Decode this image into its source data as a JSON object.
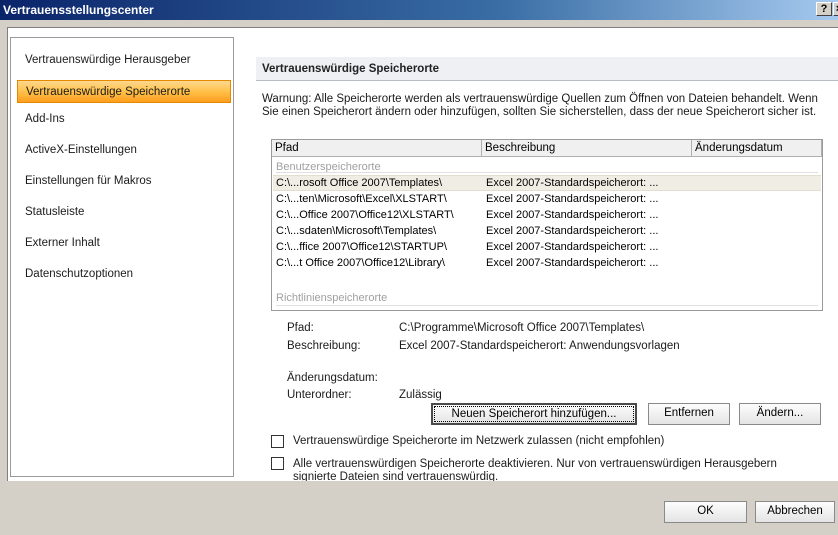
{
  "window": {
    "title": "Vertrauensstellungscenter",
    "help_glyph": "?",
    "close_glyph": "×"
  },
  "sidebar": {
    "items": [
      {
        "label": "Vertrauenswürdige Herausgeber"
      },
      {
        "label": "Vertrauenswürdige Speicherorte",
        "active": true
      },
      {
        "label": "Add-Ins"
      },
      {
        "label": "ActiveX-Einstellungen"
      },
      {
        "label": "Einstellungen für Makros"
      },
      {
        "label": "Statusleiste"
      },
      {
        "label": "Externer Inhalt"
      },
      {
        "label": "Datenschutzoptionen"
      }
    ]
  },
  "content": {
    "section_title": "Vertrauenswürdige Speicherorte",
    "warning": "Warnung: Alle Speicherorte werden als vertrauenswürdige Quellen zum Öffnen von Dateien behandelt. Wenn Sie einen Speicherort ändern oder hinzufügen, sollten Sie sicherstellen, dass der neue Speicherort sicher ist.",
    "list": {
      "columns": [
        "Pfad",
        "Beschreibung",
        "Änderungsdatum"
      ],
      "group_user": "Benutzerspeicherorte",
      "group_policy": "Richtlinienspeicherorte",
      "rows": [
        {
          "path": "C:\\...rosoft Office 2007\\Templates\\",
          "desc": "Excel 2007-Standardspeicherort: ...",
          "date": ""
        },
        {
          "path": "C:\\...ten\\Microsoft\\Excel\\XLSTART\\",
          "desc": "Excel 2007-Standardspeicherort: ...",
          "date": ""
        },
        {
          "path": "C:\\...Office 2007\\Office12\\XLSTART\\",
          "desc": "Excel 2007-Standardspeicherort: ...",
          "date": ""
        },
        {
          "path": "C:\\...sdaten\\Microsoft\\Templates\\",
          "desc": "Excel 2007-Standardspeicherort: ...",
          "date": ""
        },
        {
          "path": "C:\\...ffice 2007\\Office12\\STARTUP\\",
          "desc": "Excel 2007-Standardspeicherort: ...",
          "date": ""
        },
        {
          "path": "C:\\...t Office 2007\\Office12\\Library\\",
          "desc": "Excel 2007-Standardspeicherort: ...",
          "date": ""
        }
      ]
    },
    "details": {
      "path_label": "Pfad:",
      "path_value": "C:\\Programme\\Microsoft Office 2007\\Templates\\",
      "desc_label": "Beschreibung:",
      "desc_value": "Excel 2007-Standardspeicherort: Anwendungsvorlagen",
      "date_label": "Änderungsdatum:",
      "sub_label": "Unterordner:",
      "sub_value": "Zulässig"
    },
    "buttons": {
      "add": "Neuen Speicherort hinzufügen...",
      "remove": "Entfernen",
      "change": "Ändern..."
    },
    "checkboxes": {
      "network": "Vertrauenswürdige Speicherorte im Netzwerk zulassen (nicht empfohlen)",
      "disable": "Alle vertrauenswürdigen Speicherorte deaktivieren. Nur von vertrauenswürdigen Herausgebern signierte Dateien sind vertrauenswürdig."
    }
  },
  "footer": {
    "ok": "OK",
    "cancel": "Abbrechen"
  }
}
